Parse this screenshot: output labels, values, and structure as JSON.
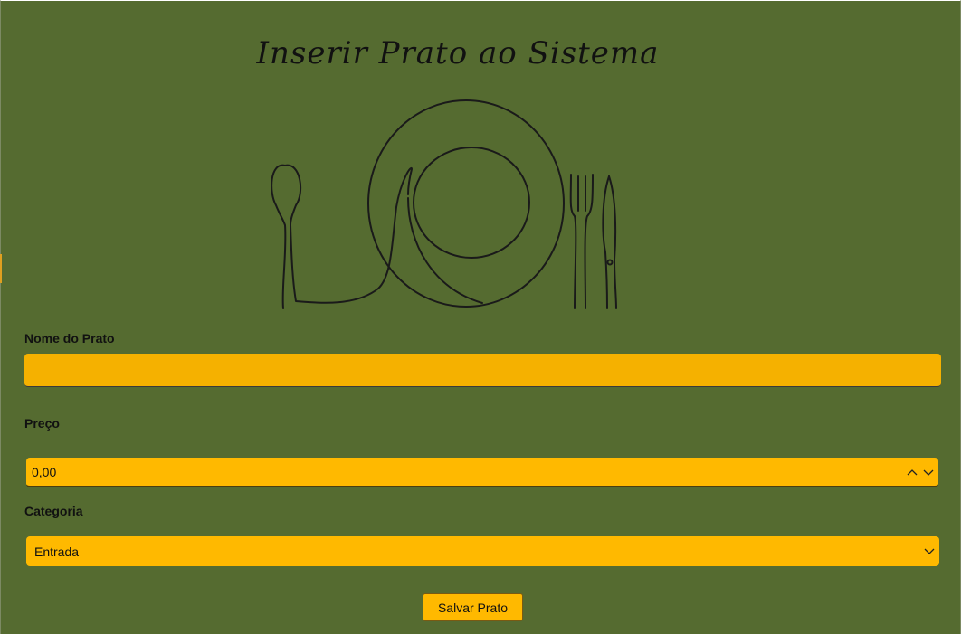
{
  "page": {
    "title": "Inserir Prato ao Sistema",
    "illustration_icon": "plate-with-cutlery-icon"
  },
  "form": {
    "name_label": "Nome do Prato",
    "name_value": "",
    "price_label": "Preço",
    "price_value": "0,00",
    "category_label": "Categoria",
    "category_value": "Entrada",
    "save_label": "Salvar Prato"
  },
  "colors": {
    "background": "#556b30",
    "field": "#ffb900",
    "text": "#111111"
  }
}
